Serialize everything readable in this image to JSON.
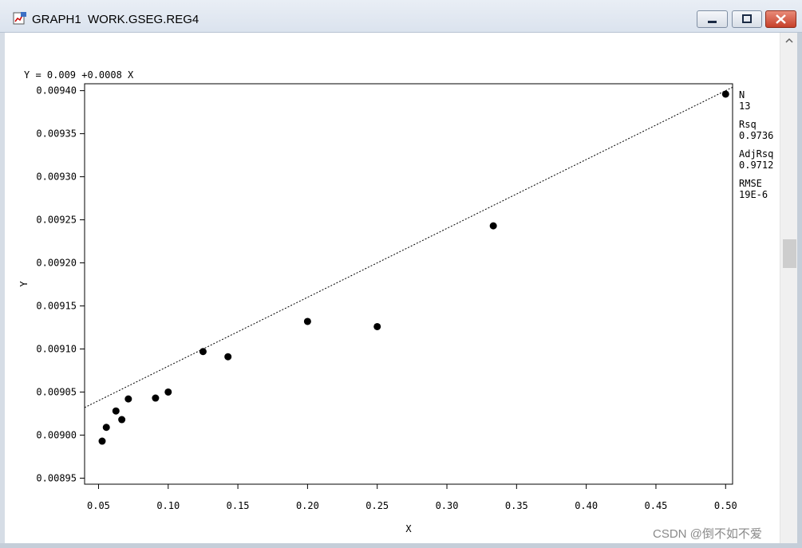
{
  "window": {
    "title": "GRAPH1  WORK.GSEG.REG4"
  },
  "equation": "Y = 0.009 +0.0008 X",
  "stats": [
    {
      "label": "N",
      "value": "13"
    },
    {
      "label": "Rsq",
      "value": "0.9736"
    },
    {
      "label": "AdjRsq",
      "value": "0.9712"
    },
    {
      "label": "RMSE",
      "value": "19E-6"
    }
  ],
  "chart_data": {
    "type": "scatter",
    "xlabel": "X",
    "ylabel": "Y",
    "xlim": [
      0.04,
      0.505
    ],
    "ylim": [
      0.008943,
      0.009408
    ],
    "x_ticks": [
      "0.05",
      "0.10",
      "0.15",
      "0.20",
      "0.25",
      "0.30",
      "0.35",
      "0.40",
      "0.45",
      "0.50"
    ],
    "y_ticks": [
      "0.00895",
      "0.00900",
      "0.00905",
      "0.00910",
      "0.00915",
      "0.00920",
      "0.00925",
      "0.00930",
      "0.00935",
      "0.00940"
    ],
    "points": [
      {
        "x": 0.0526,
        "y": 0.008993
      },
      {
        "x": 0.0556,
        "y": 0.009009
      },
      {
        "x": 0.0625,
        "y": 0.009028
      },
      {
        "x": 0.0667,
        "y": 0.009018
      },
      {
        "x": 0.0714,
        "y": 0.009042
      },
      {
        "x": 0.0909,
        "y": 0.009043
      },
      {
        "x": 0.1,
        "y": 0.00905
      },
      {
        "x": 0.125,
        "y": 0.009097
      },
      {
        "x": 0.1429,
        "y": 0.009091
      },
      {
        "x": 0.2,
        "y": 0.009132
      },
      {
        "x": 0.25,
        "y": 0.009126
      },
      {
        "x": 0.3333,
        "y": 0.009243
      },
      {
        "x": 0.5,
        "y": 0.009396
      }
    ],
    "fit_line": {
      "intercept": 0.009,
      "slope": 0.0008
    },
    "grid": false,
    "legend": "none"
  },
  "watermark": "CSDN @倒不如不爱"
}
